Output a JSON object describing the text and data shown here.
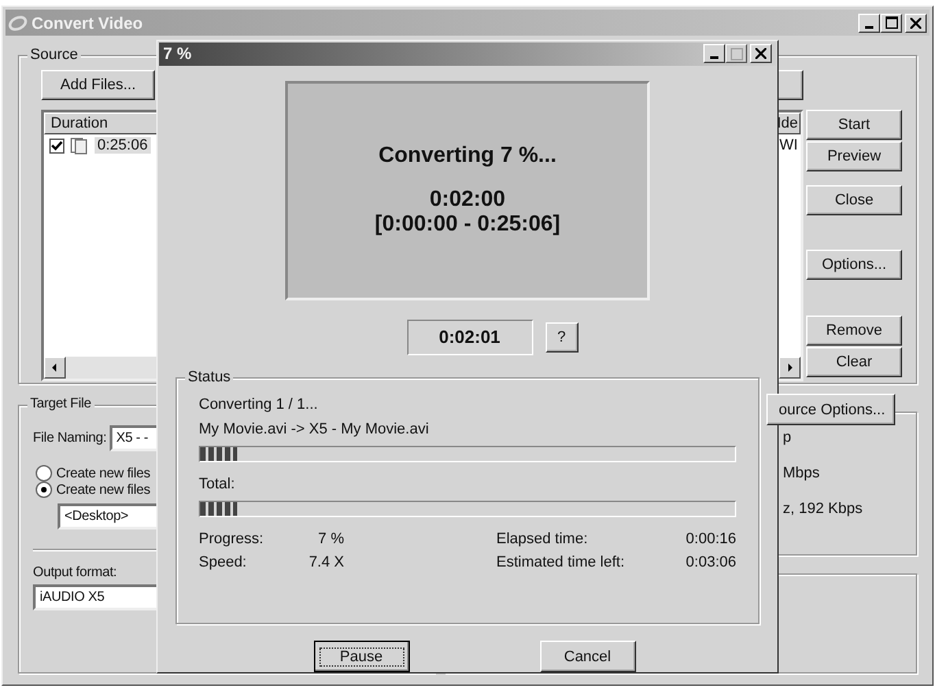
{
  "main_window": {
    "title": "Convert Video"
  },
  "source": {
    "label": "Source",
    "add_button": "Add Files...",
    "columns": [
      "Duration",
      "Ide"
    ],
    "rows": [
      {
        "checked": true,
        "duration": "0:25:06",
        "column_2": "WI"
      }
    ]
  },
  "side_buttons": [
    "Start",
    "Preview",
    "Close",
    "Options...",
    "Remove",
    "Clear"
  ],
  "target_file": {
    "label": "Target File",
    "naming_label": "File Naming:",
    "naming_value": "X5 - -",
    "options": [
      {
        "label": "Create new files",
        "selected": false
      },
      {
        "label": "Create new files",
        "selected": true
      }
    ],
    "folder": "<Desktop>",
    "output_label": "Output format:",
    "output_value": "iAUDIO X5"
  },
  "source_options": {
    "button": "ource Options...",
    "lines": [
      "p",
      "Mbps",
      "z, 192 Kbps"
    ]
  },
  "dialog": {
    "title": "7 %",
    "preview_heading": "Converting 7 %...",
    "preview_lines": [
      "0:02:00",
      "[0:00:00 - 0:25:06]"
    ],
    "time": "0:02:01",
    "help_button": "?",
    "status_label": "Status",
    "status_line": "Converting 1 / 1...",
    "file_line": "My Movie.avi -> X5 - My Movie.avi",
    "file_progress": {
      "level": 0.07
    },
    "total_label": "Total:",
    "total_progress": {
      "level": 0.07
    },
    "stats": [
      {
        "label": "Progress:",
        "value": "7 %"
      },
      {
        "label": "Speed:",
        "value": "7.4 X"
      }
    ],
    "times": [
      {
        "label": "Elapsed time:",
        "value": "0:00:16"
      },
      {
        "label": "Estimated time left:",
        "value": "0:03:06"
      }
    ],
    "buttons": [
      {
        "label": "Pause",
        "focused": true
      },
      {
        "label": "Cancel",
        "focused": false
      }
    ]
  }
}
